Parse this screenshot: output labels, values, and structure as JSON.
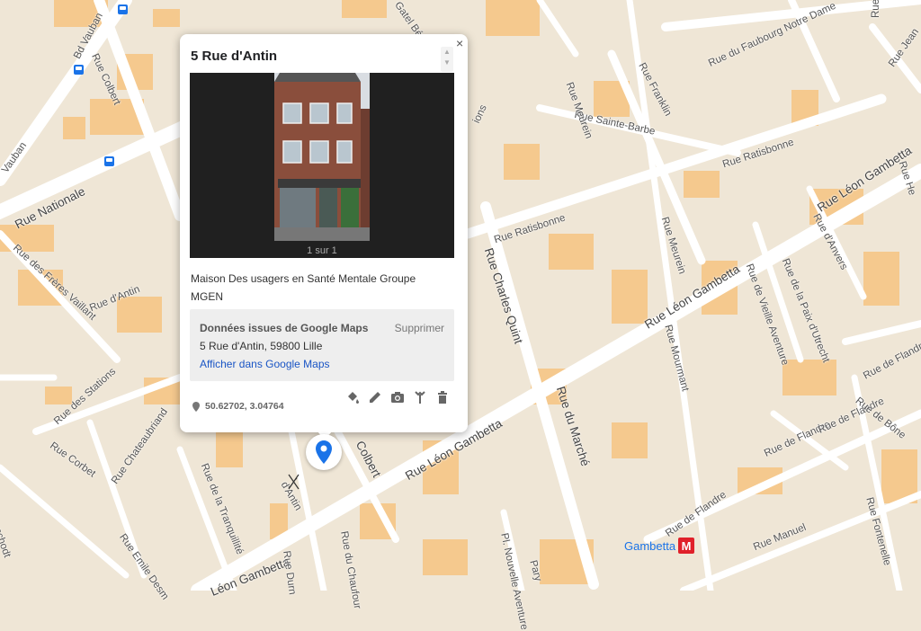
{
  "map": {
    "streets": [
      {
        "id": "rue-nationale",
        "label": "Rue Nationale"
      },
      {
        "id": "bd-vauban",
        "label": "Bd Vauban"
      },
      {
        "id": "vauban",
        "label": "Vauban"
      },
      {
        "id": "rue-colbert-top",
        "label": "Rue Colbert"
      },
      {
        "id": "rue-des-freres-vaillant",
        "label": "Rue des Frères Vaillant"
      },
      {
        "id": "rue-d-antin-left",
        "label": "Rue d'Antin"
      },
      {
        "id": "rue-des-stations",
        "label": "Rue des Stations"
      },
      {
        "id": "rue-corbet",
        "label": "Rue Corbet"
      },
      {
        "id": "rue-chateaubriand",
        "label": "Rue Chateaubriand"
      },
      {
        "id": "rue-de-la-tranquillite",
        "label": "Rue de la Tranquillité"
      },
      {
        "id": "rue-emile-desmet",
        "label": "Rue Emile Desm"
      },
      {
        "id": "rue-leon-gambetta-bottom",
        "label": "Léon Gambetta"
      },
      {
        "id": "rue-d-antin-bottom",
        "label": "d'Antin"
      },
      {
        "id": "rue-colbert-bottom",
        "label": "Colbert"
      },
      {
        "id": "rue-leon-gambetta-mid",
        "label": "Rue Léon Gambetta"
      },
      {
        "id": "rue-leon-gambetta-center",
        "label": "Rue Léon Gambetta"
      },
      {
        "id": "rue-leon-gambetta-right",
        "label": "Rue Léon Gambetta"
      },
      {
        "id": "rue-charles-quint",
        "label": "Rue Charles Quint"
      },
      {
        "id": "rue-du-marche",
        "label": "Rue du Marché"
      },
      {
        "id": "rue-ratisbonne-left",
        "label": "Rue Ratisbonne"
      },
      {
        "id": "rue-ratisbonne-right",
        "label": "Rue Ratisbonne"
      },
      {
        "id": "rue-sainte-barbe",
        "label": "Rue Sainte-Barbe"
      },
      {
        "id": "rue-meurein-top",
        "label": "Rue Meurein"
      },
      {
        "id": "rue-meurein-mid",
        "label": "Rue Meurein"
      },
      {
        "id": "rue-franklin",
        "label": "Rue Franklin"
      },
      {
        "id": "rue-du-faubourg-notre-dame",
        "label": "Rue du Faubourg Notre Dame"
      },
      {
        "id": "rue-d-anvers",
        "label": "Rue d'Anvers"
      },
      {
        "id": "rue-de-la-paix-d-utrecht",
        "label": "Rue de la Paix d'Utrecht"
      },
      {
        "id": "rue-de-vieille-aventure",
        "label": "Rue de Vieille Aventure"
      },
      {
        "id": "rue-mourmant",
        "label": "Rue Mourmant"
      },
      {
        "id": "rue-de-flandre-right",
        "label": "Rue de Flandre"
      },
      {
        "id": "rue-de-flandre-mid",
        "label": "Rue de Flandre"
      },
      {
        "id": "rue-de-flandre-low",
        "label": "Rue de Flandre"
      },
      {
        "id": "rue-de-flandre-bottom",
        "label": "Rue de Flandre"
      },
      {
        "id": "rue-de-boue",
        "label": "Rue de Bône"
      },
      {
        "id": "rue-manuel",
        "label": "Rue Manuel"
      },
      {
        "id": "rue-fontenelle",
        "label": "Rue Fontenelle"
      },
      {
        "id": "pl-nouvelle-aventure",
        "label": "Pl. Nouvelle Aventure"
      },
      {
        "id": "rue-du-chaufour",
        "label": "Rue du Chaufour"
      },
      {
        "id": "rue-jean",
        "label": "Rue Jean"
      },
      {
        "id": "rue-he",
        "label": "Rue He"
      },
      {
        "id": "rue-i",
        "label": "Rue I"
      },
      {
        "id": "pary",
        "label": "Pary"
      },
      {
        "id": "rue-durn",
        "label": "Rue Durn"
      },
      {
        "id": "ions",
        "label": "ions"
      },
      {
        "id": "rue-eschodt",
        "label": "eschodt"
      },
      {
        "id": "rue-gatel",
        "label": "Gatel Béc"
      }
    ],
    "metro": {
      "name": "Gambetta"
    }
  },
  "popup": {
    "title": "5 Rue d'Antin",
    "photo_counter": "1 sur 1",
    "description": "Maison Des usagers en Santé Mentale Groupe MGEN",
    "source_heading": "Données issues de Google Maps",
    "delete_label": "Supprimer",
    "address": "5 Rue d'Antin, 59800 Lille",
    "maps_link": "Afficher dans Google Maps",
    "coordinates": "50.62702, 3.04764",
    "close_symbol": "×",
    "tools": [
      "paint-bucket-icon",
      "pencil-icon",
      "camera-icon",
      "directions-icon",
      "trash-icon"
    ]
  },
  "colors": {
    "map_background": "#efe6d6",
    "road": "#ffffff",
    "building": "#f5c98e",
    "marker": "#1a73e8",
    "link": "#1a55c5"
  }
}
